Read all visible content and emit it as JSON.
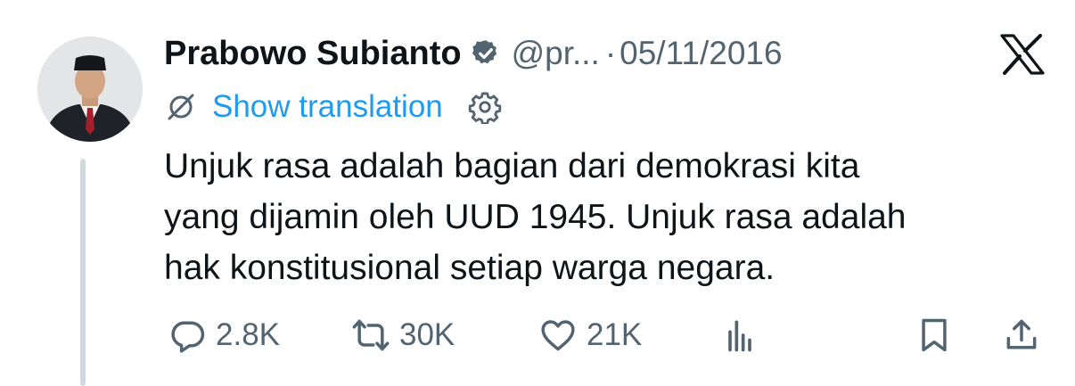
{
  "author": {
    "name": "Prabowo Subianto",
    "handle": "@pr...",
    "separator": "·",
    "date": "05/11/2016"
  },
  "translation": {
    "label": "Show translation"
  },
  "tweet": {
    "lines": [
      "Unjuk rasa adalah bagian dari demokrasi kita",
      "yang dijamin oleh UUD 1945. Unjuk rasa adalah",
      "hak konstitusional setiap warga negara."
    ]
  },
  "actions": {
    "replies": "2.8K",
    "reposts": "30K",
    "likes": "21K"
  },
  "colors": {
    "text_primary": "#0f1419",
    "text_secondary": "#536471",
    "link_blue": "#1d9bf0",
    "thread_line": "#cfd9de"
  },
  "icons": {
    "verified": "verified-badge-icon",
    "brand": "x-logo-icon",
    "translate": "translate-icon",
    "settings": "gear-icon",
    "reply": "reply-icon",
    "repost": "repost-icon",
    "like": "heart-icon",
    "views": "analytics-icon",
    "bookmark": "bookmark-icon",
    "share": "share-icon"
  }
}
